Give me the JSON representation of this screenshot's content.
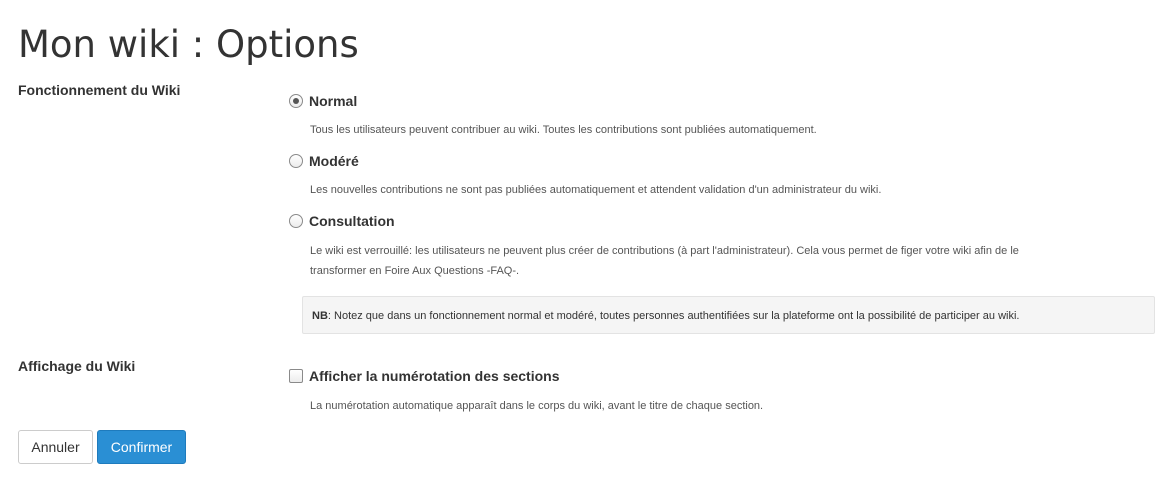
{
  "page": {
    "title": "Mon wiki : Options"
  },
  "mode": {
    "label": "Fonctionnement du Wiki",
    "options": [
      {
        "label": "Normal",
        "checked": true,
        "help": "Tous les utilisateurs peuvent contribuer au wiki. Toutes les contributions sont publiées automatiquement."
      },
      {
        "label": "Modéré",
        "checked": false,
        "help": "Les nouvelles contributions ne sont pas publiées automatiquement et attendent validation d'un administrateur du wiki."
      },
      {
        "label": "Consultation",
        "checked": false,
        "help_line1": "Le wiki est verrouillé: les utilisateurs ne peuvent plus créer de contributions (à part l'administrateur). Cela vous permet de figer votre wiki afin de le",
        "help_line2": "transformer en Foire Aux Questions -FAQ-."
      }
    ],
    "note_prefix": "NB",
    "note_text": ": Notez que dans un fonctionnement normal et modéré, toutes personnes authentifiées sur la plateforme ont la possibilité de participer au wiki."
  },
  "display": {
    "label": "Affichage du Wiki",
    "option_label": "Afficher la numérotation des sections",
    "checked": false,
    "help": "La numérotation automatique apparaît dans le corps du wiki, avant le titre de chaque section."
  },
  "actions": {
    "cancel_label": "Annuler",
    "confirm_label": "Confirmer"
  },
  "colors": {
    "primary": "#2a8fd4",
    "text": "#333333"
  }
}
